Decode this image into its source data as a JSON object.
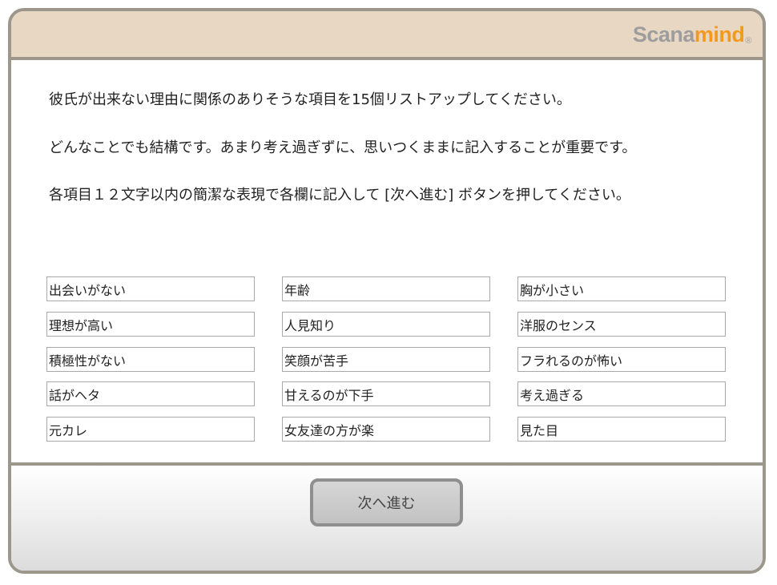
{
  "header": {
    "logo_part1": "Scana",
    "logo_part2": "mind",
    "logo_mark": "®",
    "background_color": "#e8d8c3",
    "accent_color": "#f39a1e"
  },
  "instructions": [
    "彼氏が出来ない理由に関係のありそうな項目を15個リストアップしてください。",
    "どんなことでも結構です。あまり考え過ぎずに、思いつくままに記入することが重要です。",
    "各項目１２文字以内の簡潔な表現で各欄に記入して [次へ進む] ボタンを押してください。"
  ],
  "answers": [
    [
      "出会いがない",
      "年齢",
      "胸が小さい"
    ],
    [
      "理想が高い",
      "人見知り",
      "洋服のセンス"
    ],
    [
      "積極性がない",
      "笑顔が苦手",
      "フラれるのが怖い"
    ],
    [
      "話がヘタ",
      "甘えるのが下手",
      "考え過ぎる"
    ],
    [
      "元カレ",
      "女友達の方が楽",
      "見た目"
    ]
  ],
  "footer": {
    "next_label": "次へ進む"
  }
}
